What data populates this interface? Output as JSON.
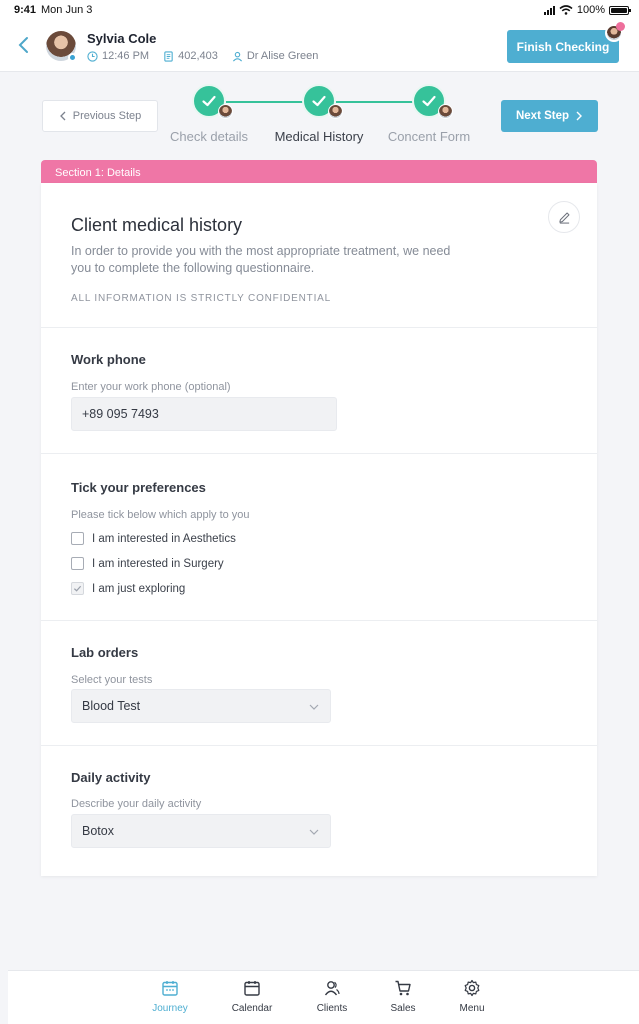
{
  "status_bar": {
    "time": "9:41",
    "date": "Mon Jun 3",
    "battery": "100%"
  },
  "header": {
    "patient_name": "Sylvia Cole",
    "time": "12:46 PM",
    "record_id": "402,403",
    "doctor": "Dr Alise Green",
    "finish_label": "Finish Checking"
  },
  "steps": {
    "prev_label": "Previous Step",
    "next_label": "Next Step",
    "items": [
      {
        "label": "Check details"
      },
      {
        "label": "Medical History"
      },
      {
        "label": "Concent Form"
      }
    ]
  },
  "section": {
    "tab_label": "Section 1: Details",
    "title": "Client medical history",
    "description": "In order to provide you with the most appropriate treatment, we need you to complete the following questionnaire.",
    "note": "ALL INFORMATION IS STRICTLY CONFIDENTIAL"
  },
  "questions": {
    "work_phone": {
      "title": "Work phone",
      "hint": "Enter your work phone (optional)",
      "value": "+89 095 7493"
    },
    "preferences": {
      "title": "Tick your preferences",
      "hint": "Please tick below which apply to you",
      "options": [
        {
          "label": "I am interested in Aesthetics",
          "checked": false
        },
        {
          "label": "I am interested in Surgery",
          "checked": false
        },
        {
          "label": "I am just exploring",
          "checked": true
        }
      ]
    },
    "lab_orders": {
      "title": "Lab orders",
      "hint": "Select your tests",
      "value": "Blood Test"
    },
    "daily_activity": {
      "title": "Daily activity",
      "hint": "Describe your daily activity",
      "value": "Botox"
    }
  },
  "tabbar": {
    "items": [
      {
        "label": "Journey",
        "icon": "calendar-icon",
        "active": true
      },
      {
        "label": "Calendar",
        "icon": "calendar-icon",
        "active": false
      },
      {
        "label": "Clients",
        "icon": "users-icon",
        "active": false
      },
      {
        "label": "Sales",
        "icon": "cart-icon",
        "active": false
      },
      {
        "label": "Menu",
        "icon": "gear-icon",
        "active": false
      }
    ]
  },
  "colors": {
    "accent": "#4eaed1",
    "step_done": "#36c29a",
    "section_tab": "#ef76a6"
  }
}
